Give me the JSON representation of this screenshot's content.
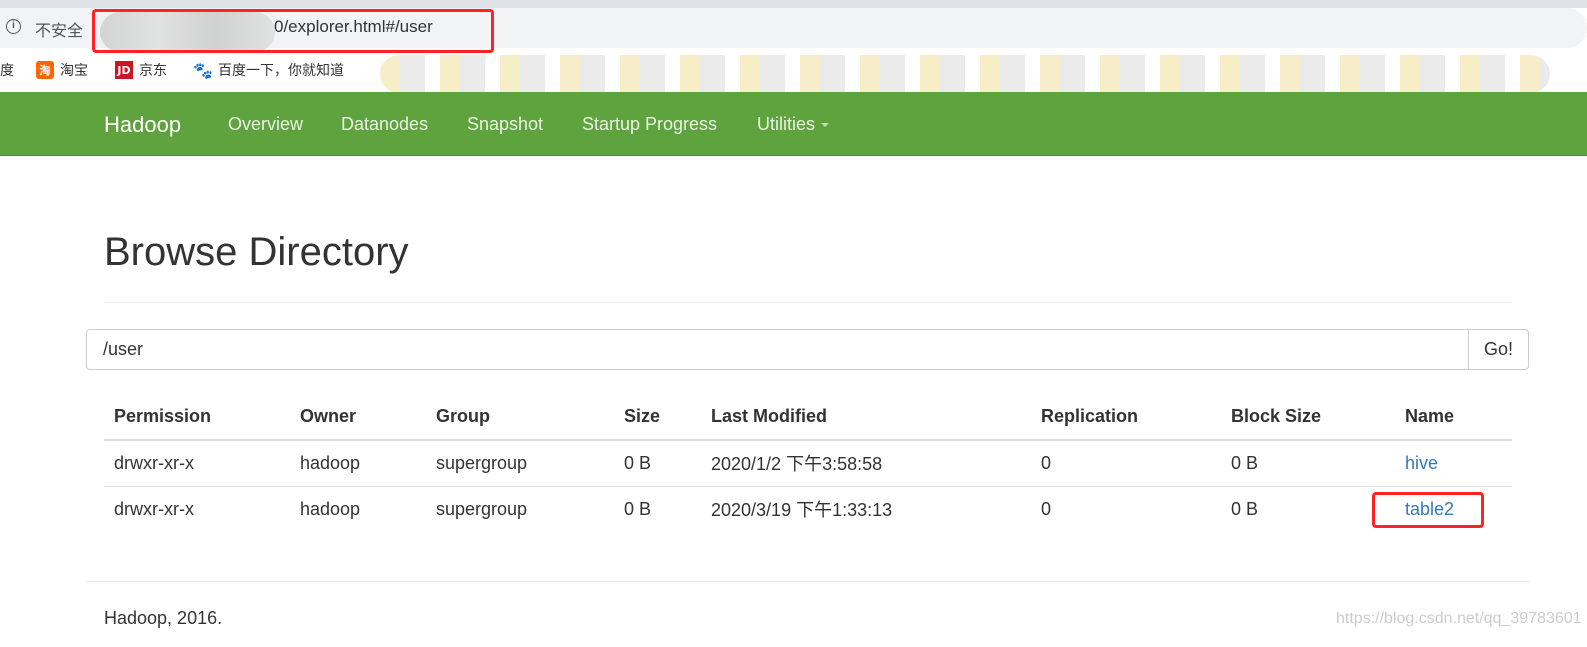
{
  "browser": {
    "insecure_label": "不安全",
    "url_visible": "0/explorer.html#/user",
    "bookmarks": [
      {
        "label": "度"
      },
      {
        "label": "淘宝",
        "icon": "taobao-icon",
        "icon_text": "淘",
        "color": "#f40"
      },
      {
        "label": "京东",
        "icon": "jd-icon",
        "icon_text": "JD",
        "color": "#c81623"
      },
      {
        "label": "百度一下，你就知道",
        "icon": "baidu-paw-icon",
        "color": "#2f7ff0"
      }
    ]
  },
  "nav": {
    "brand": "Hadoop",
    "items": [
      "Overview",
      "Datanodes",
      "Snapshot",
      "Startup Progress",
      "Utilities"
    ],
    "color": "#5fa33e"
  },
  "page": {
    "title": "Browse Directory",
    "path_value": "/user",
    "go_label": "Go!"
  },
  "table": {
    "headers": [
      "Permission",
      "Owner",
      "Group",
      "Size",
      "Last Modified",
      "Replication",
      "Block Size",
      "Name"
    ],
    "rows": [
      [
        "drwxr-xr-x",
        "hadoop",
        "supergroup",
        "0 B",
        "2020/1/2 下午3:58:58",
        "0",
        "0 B",
        "hive"
      ],
      [
        "drwxr-xr-x",
        "hadoop",
        "supergroup",
        "0 B",
        "2020/3/19 下午1:33:13",
        "0",
        "0 B",
        "table2"
      ]
    ]
  },
  "footer": {
    "text": "Hadoop, 2016."
  },
  "watermark": "https://blog.csdn.net/qq_39783601",
  "annotation_color": "#ff2222"
}
